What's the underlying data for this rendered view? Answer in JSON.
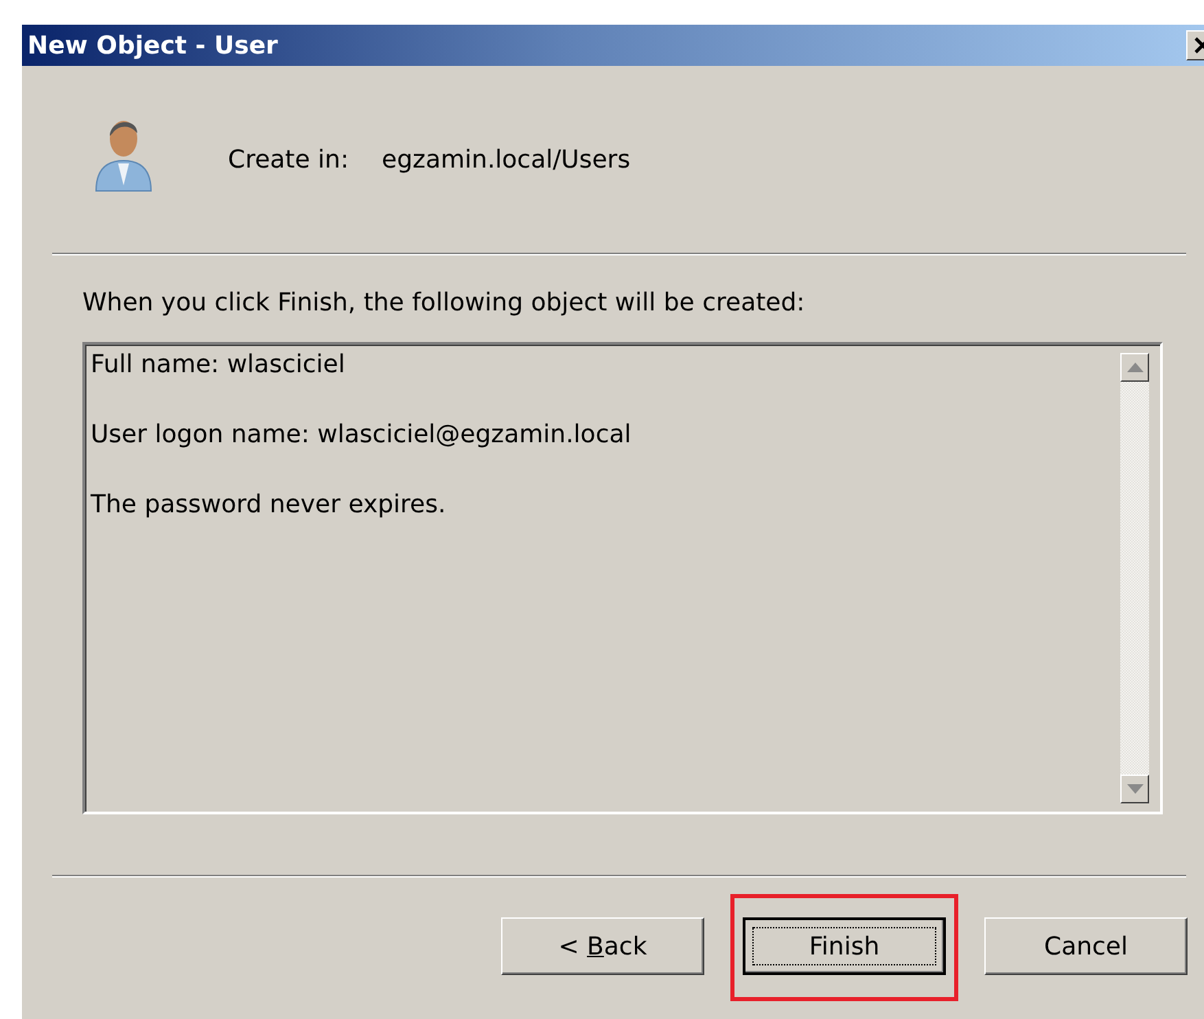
{
  "window": {
    "title": "New Object - User"
  },
  "header": {
    "label": "Create in:",
    "value": "egzamin.local/Users"
  },
  "intro": "When you click Finish, the following object will be created:",
  "summary": [
    "Full name: wlasciciel",
    "User logon name: wlasciciel@egzamin.local",
    "The password never expires."
  ],
  "buttons": [
    {
      "label": "< ",
      "access_key": "B",
      "label_after": "ack",
      "focused": false,
      "highlighted": false
    },
    {
      "label": "Finish",
      "focused": true,
      "highlighted": true
    },
    {
      "label": "Cancel",
      "focused": false,
      "highlighted": false
    }
  ]
}
